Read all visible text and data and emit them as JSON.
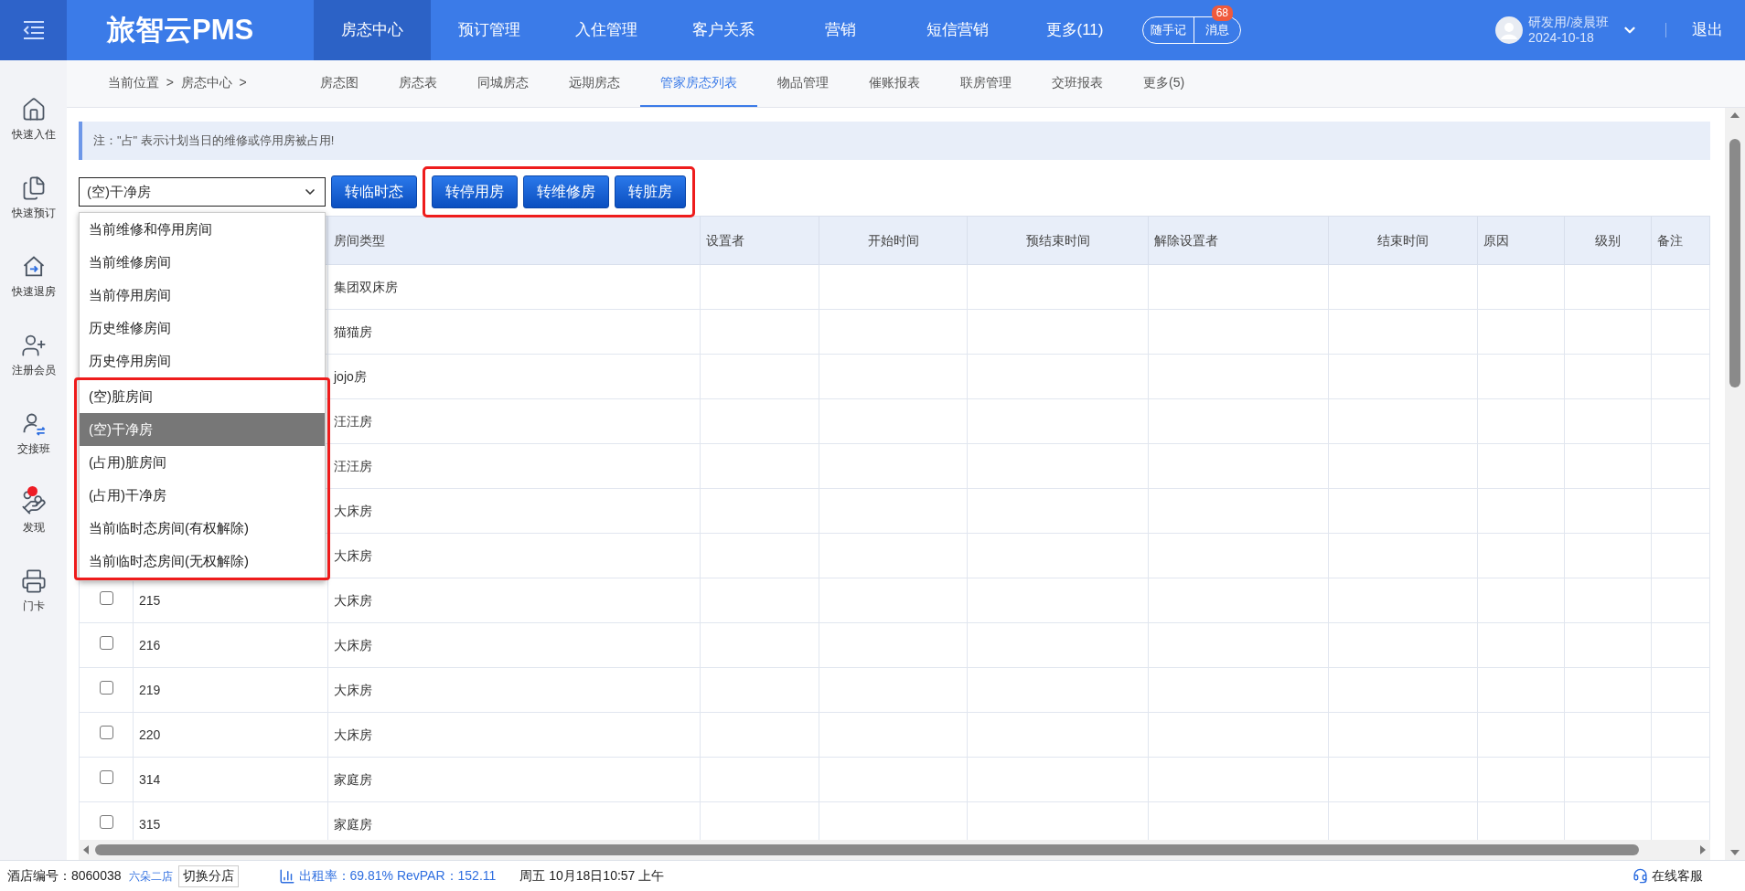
{
  "top_bar": {
    "logo": "旅智云PMS",
    "nav": [
      {
        "label": "房态中心",
        "selected": true
      },
      {
        "label": "预订管理",
        "selected": false
      },
      {
        "label": "入住管理",
        "selected": false
      },
      {
        "label": "客户关系",
        "selected": false
      },
      {
        "label": "营销",
        "selected": false
      },
      {
        "label": "短信营销",
        "selected": false
      },
      {
        "label": "更多(11)",
        "selected": false
      }
    ],
    "notes_button": "随手记",
    "messages_button": "消息",
    "messages_count": "68",
    "user": "研发用/凌晨班",
    "date": "2024-10-18",
    "logout": "退出"
  },
  "sidebar": {
    "items": [
      {
        "label": "快速入住",
        "notification": false
      },
      {
        "label": "快速预订",
        "notification": false
      },
      {
        "label": "快速退房",
        "notification": false
      },
      {
        "label": "注册会员",
        "notification": false
      },
      {
        "label": "交接班",
        "notification": false
      },
      {
        "label": "发现",
        "notification": true
      },
      {
        "label": "门卡",
        "notification": false
      }
    ]
  },
  "sub_nav": {
    "breadcrumb": "当前位置  >  房态中心  >",
    "tabs": [
      {
        "label": "房态图",
        "selected": false
      },
      {
        "label": "房态表",
        "selected": false
      },
      {
        "label": "同城房态",
        "selected": false
      },
      {
        "label": "远期房态",
        "selected": false
      },
      {
        "label": "管家房态列表",
        "selected": true
      },
      {
        "label": "物品管理",
        "selected": false
      },
      {
        "label": "催账报表",
        "selected": false
      },
      {
        "label": "联房管理",
        "selected": false
      },
      {
        "label": "交班报表",
        "selected": false
      },
      {
        "label": "更多(5)",
        "selected": false
      }
    ]
  },
  "notice": "注：\"占\" 表示计划当日的维修或停用房被占用!",
  "filter": {
    "value": "(空)干净房",
    "options": [
      {
        "label": "当前维修和停用房间",
        "selected": false
      },
      {
        "label": "当前维修房间",
        "selected": false
      },
      {
        "label": "当前停用房间",
        "selected": false
      },
      {
        "label": "历史维修房间",
        "selected": false
      },
      {
        "label": "历史停用房间",
        "selected": false
      }
    ],
    "highlighted_options": [
      {
        "label": "(空)脏房间",
        "selected": false
      },
      {
        "label": "(空)干净房",
        "selected": true
      },
      {
        "label": "(占用)脏房间",
        "selected": false
      },
      {
        "label": "(占用)干净房",
        "selected": false
      },
      {
        "label": "当前临时态房间(有权解除)",
        "selected": false
      },
      {
        "label": "当前临时态房间(无权解除)",
        "selected": false
      }
    ]
  },
  "actions": [
    "转临时态"
  ],
  "highlighted_actions": [
    "转停用房",
    "转维修房",
    "转脏房"
  ],
  "table": {
    "columns": [
      "房间类型",
      "设置者",
      "开始时间",
      "预结束时间",
      "解除设置者",
      "结束时间",
      "原因",
      "级别",
      "备注"
    ],
    "rows": [
      {
        "room_type": "集团双床房"
      },
      {
        "room_type": "猫猫房"
      },
      {
        "room_type": "jojo房"
      },
      {
        "room_type": "汪汪房"
      },
      {
        "room_type": "汪汪房"
      },
      {
        "room_type": "大床房"
      },
      {
        "room_type": "大床房"
      },
      {
        "checked": false,
        "room_number": "215",
        "room_type": "大床房"
      },
      {
        "checked": false,
        "room_number": "216",
        "room_type": "大床房"
      },
      {
        "checked": false,
        "room_number": "219",
        "room_type": "大床房"
      },
      {
        "checked": false,
        "room_number": "220",
        "room_type": "大床房"
      },
      {
        "checked": false,
        "room_number": "314",
        "room_type": "家庭房"
      },
      {
        "checked": false,
        "room_number": "315",
        "room_type": "家庭房"
      }
    ]
  },
  "status_bar": {
    "hotel_label": "酒店编号：8060038",
    "store": "六朵二店",
    "switch_button": "切换分店",
    "occupancy": "出租率：69.81% RevPAR：152.11",
    "datetime": "周五 10月18日10:57 上午",
    "support": "在线客服"
  }
}
